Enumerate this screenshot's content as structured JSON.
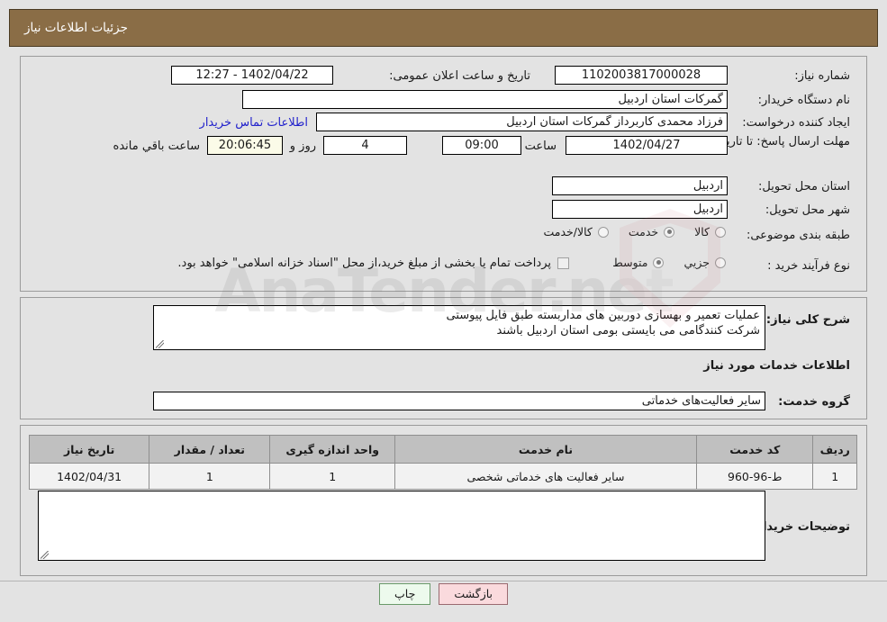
{
  "header": {
    "title": "جزئیات اطلاعات نیاز"
  },
  "watermark": {
    "text": "AnaTender.net",
    "shield_icon": "shield-icon"
  },
  "top_section": {
    "need_number_label": "شماره نیاز:",
    "need_number_value": "1102003817000028",
    "public_announce_label": "تاریخ و ساعت اعلان عمومی:",
    "public_announce_value": "1402/04/22 - 12:27",
    "buyer_org_label": "نام دستگاه خریدار:",
    "buyer_org_value": "گمرکات استان اردبیل",
    "creator_label": "ایجاد کننده درخواست:",
    "creator_value": "فرزاد محمدی کاربرداز گمرکات استان اردبیل",
    "buyer_contact_link": "اطلاعات تماس خریدار",
    "deadline_label": "مهلت ارسال پاسخ: تا تاریخ:",
    "deadline_date": "1402/04/27",
    "time_label": "ساعت",
    "deadline_time": "09:00",
    "days_remaining": "4",
    "days_unit_label": "روز و",
    "countdown": "20:06:45",
    "countdown_suffix_label": "ساعت باقي مانده",
    "province_label": "استان محل تحویل:",
    "province_value": "اردبیل",
    "city_label": "شهر محل تحویل:",
    "city_value": "اردبیل",
    "category_label": "طبقه بندی موضوعی:",
    "category_options": [
      {
        "label": "کالا",
        "selected": false
      },
      {
        "label": "خدمت",
        "selected": true
      },
      {
        "label": "کالا/خدمت",
        "selected": false
      }
    ],
    "process_type_label": "نوع فرآیند خرید :",
    "process_type_options": [
      {
        "label": "جزیي",
        "selected": false
      },
      {
        "label": "متوسط",
        "selected": true
      }
    ],
    "treasury_checkbox_checked": false,
    "treasury_note": "پرداخت تمام یا بخشی از مبلغ خرید،از محل \"اسناد خزانه اسلامی\" خواهد بود."
  },
  "mid_section": {
    "general_desc_label": "شرح کلی نیاز:",
    "general_desc_value": "عملیات تعمیر و بهسازی دوربین های مداربسته طبق فایل پیوستی\nشرکت کنندگامی می بایستی بومی استان اردبیل باشند",
    "services_heading": "اطلاعات خدمات مورد نیاز",
    "service_group_label": "گروه خدمت:",
    "service_group_value": "سایر فعالیت‌های خدماتی"
  },
  "table": {
    "columns": [
      "ردیف",
      "کد خدمت",
      "نام خدمت",
      "واحد اندازه گیری",
      "تعداد / مقدار",
      "تاریخ نیاز"
    ],
    "rows": [
      {
        "row": "1",
        "service_code": "ط-96-960",
        "service_name": "سایر فعالیت های خدماتی شخصی",
        "unit": "1",
        "quantity": "1",
        "need_date": "1402/04/31"
      }
    ]
  },
  "bottom_section": {
    "buyer_notes_label": "توضیحات خریدار:",
    "buyer_notes_value": ""
  },
  "footer": {
    "back_label": "بازگشت",
    "print_label": "چاپ"
  }
}
